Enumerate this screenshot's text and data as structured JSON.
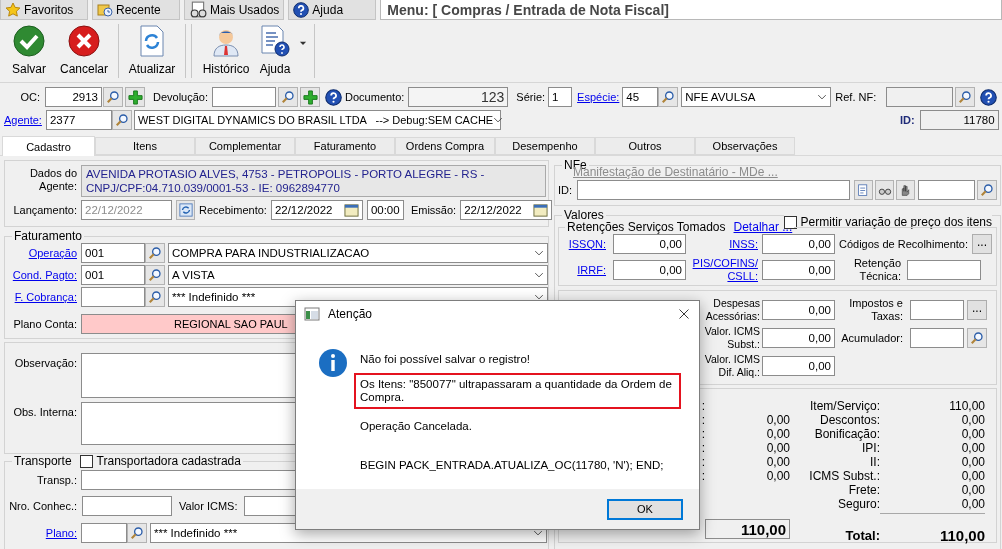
{
  "nav_tabs": [
    {
      "label": "Favoritos"
    },
    {
      "label": "Recente"
    },
    {
      "label": "Mais Usados"
    },
    {
      "label": "Ajuda"
    }
  ],
  "menu_title": "Menu: [ Compras / Entrada de Nota Fiscal]",
  "toolbar": [
    {
      "label": "Salvar",
      "dropdown": false
    },
    {
      "label": "Cancelar",
      "dropdown": false
    },
    {
      "label": "Atualizar",
      "dropdown": false
    },
    {
      "label": "Histórico",
      "dropdown": false
    },
    {
      "label": "Ajuda",
      "dropdown": true
    }
  ],
  "header": {
    "oc_label": "OC:",
    "oc": "2913",
    "devolucao_label": "Devolução:",
    "documento_label": "Documento:",
    "documento": "123",
    "serie_label": "Série:",
    "serie": "1",
    "especie_label": "Espécie:",
    "especie": "45",
    "especie_name": "NFE AVULSA",
    "ref_nf_label": "Ref. NF:",
    "agente_label": "Agente:",
    "agente": "2377",
    "agente_name": "WEST DIGITAL DYNAMICS DO BRASIL LTDA   --> Debug:SEM CACHE",
    "id_label": "ID:",
    "id": "11780"
  },
  "tabs": [
    {
      "label": "Cadastro",
      "selected": true
    },
    {
      "label": "Itens",
      "selected": false
    },
    {
      "label": "Complementar",
      "selected": false
    },
    {
      "label": "Faturamento",
      "selected": false
    },
    {
      "label": "Ordens Compra",
      "selected": false
    },
    {
      "label": "Desempenho",
      "selected": false
    },
    {
      "label": "Outros",
      "selected": false
    },
    {
      "label": "Observações",
      "selected": false
    }
  ],
  "agent": {
    "label": "Dados do Agente:",
    "address_lines": [
      "AVENIDA PROTASIO ALVES, 4753 - PETROPOLIS - PORTO ALEGRE - RS -",
      "CNPJ/CPF:04.710.039/0001-53 - IE: 0962894770"
    ]
  },
  "dates": {
    "lancamento_label": "Lançamento:",
    "lancamento": "22/12/2022",
    "recebimento_label": "Recebimento:",
    "recebimento": "22/12/2022",
    "hora": "00:00",
    "emissao_label": "Emissão:",
    "emissao": "22/12/2022"
  },
  "faturamento": {
    "title": "Faturamento",
    "rows": [
      {
        "label": "Operação",
        "code": "001",
        "name": "COMPRA PARA INDUSTRIALIZACAO"
      },
      {
        "label": "Cond. Pagto:",
        "code": "001",
        "name": "A VISTA"
      },
      {
        "label": "F. Cobrança:",
        "name": "*** Indefinido ***"
      }
    ],
    "plano_label": "Plano Conta:",
    "plano": "REGIONAL SAO PAUL"
  },
  "observacao_label": "Observação:",
  "obs_interna_label": "Obs. Interna:",
  "transporte": {
    "title": "Transporte",
    "cadastrada": {
      "label": "Transportadora cadastrada",
      "checked": false
    },
    "transp_label": "Transp.:",
    "conhec_label": "Nro. Conhec.:",
    "icms_label": "Valor ICMS:",
    "plano_label": "Plano:",
    "plano": "*** Indefinido ***"
  },
  "nfe": {
    "title": "NFe",
    "mde_link": {
      "text": "Manifestação de Destinatário - MDe ...",
      "disabled": true
    },
    "id_label": "ID:"
  },
  "valores": {
    "title": "Valores",
    "variacao": {
      "label": "Permitir variação de preço dos itens",
      "checked": false
    },
    "retencoes": {
      "title": "Retenções Serviços Tomados",
      "detail_link": "Detalhar ...",
      "issqn_label": "ISSQN:",
      "issqn": "0,00",
      "inss_label": "INSS:",
      "inss": "0,00",
      "codigos_label": "Códigos de Recolhimento:",
      "codigos_button": "...",
      "irrf_label": "IRRF:",
      "irrf": "0,00",
      "pis_label": "PIS/COFINS/ CSLL:",
      "pis": "0,00",
      "retencao_label": "Retenção Técnica:"
    },
    "despesas": {
      "despesas_label": "Despesas Acessórias:",
      "despesas": "0,00",
      "impostos_label": "Impostos e Taxas:",
      "impostos_button": "...",
      "icms_subst_label": "Valor. ICMS Subst.:",
      "icms_subst": "0,00",
      "acumulador_label": "Acumulador:",
      "icms_dif_label": "Valor. ICMS Dif. Aliq.:",
      "icms_dif": "0,00"
    },
    "totals": {
      "left": [
        {
          "label": ":"
        },
        {
          "label": ":",
          "value": "0,00"
        },
        {
          "label": ":",
          "value": "0,00"
        },
        {
          "label": ":",
          "value": "0,00"
        },
        {
          "label": ":",
          "value": "0,00"
        },
        {
          "label": ":",
          "value": "0,00"
        }
      ],
      "right": [
        {
          "label": "Item/Serviço:",
          "value": "110,00"
        },
        {
          "label": "Descontos:",
          "value": "0,00"
        },
        {
          "label": "Bonificação:",
          "value": "0,00"
        },
        {
          "label": "IPI:",
          "value": "0,00"
        },
        {
          "label": "II:",
          "value": "0,00"
        },
        {
          "label": "ICMS Subst.:",
          "value": "0,00"
        },
        {
          "label": "Frete:",
          "value": "0,00"
        },
        {
          "label": "Seguro:",
          "value": "0,00"
        }
      ],
      "informado": "110,00",
      "total_label": "Total:",
      "total": "110,00"
    }
  },
  "dialog": {
    "title": "Atenção",
    "lines": [
      {
        "text": "Não foi possível salvar o registro!",
        "highlighted": false
      },
      {
        "text": "Os Itens: \"850077\" ultrapassaram a quantidade da Ordem de Compra.",
        "highlighted": true
      },
      {
        "text": "Operação Cancelada.",
        "highlighted": false
      },
      {
        "text": "BEGIN PACK_ENTRADA.ATUALIZA_OC(11780, 'N'); END;",
        "highlighted": false
      }
    ],
    "button": "OK"
  }
}
